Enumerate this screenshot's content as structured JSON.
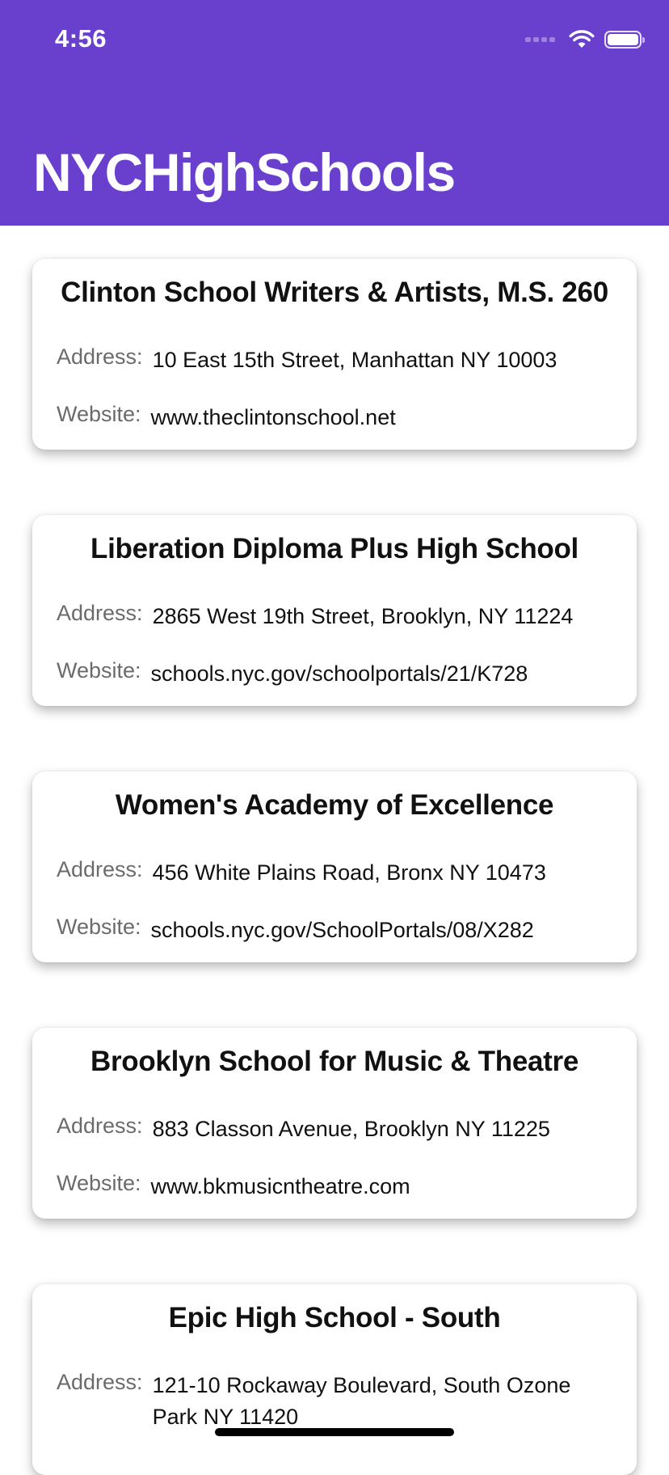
{
  "status_bar": {
    "time": "4:56"
  },
  "header": {
    "title": "NYCHighSchools",
    "background_color": "#6940CE"
  },
  "labels": {
    "address": "Address:",
    "website": "Website:"
  },
  "schools": [
    {
      "name": "Clinton School Writers & Artists, M.S. 260",
      "address": "10 East 15th Street, Manhattan NY 10003",
      "website": "www.theclintonschool.net"
    },
    {
      "name": "Liberation Diploma Plus High School",
      "address": "2865 West 19th Street, Brooklyn, NY 11224",
      "website": "schools.nyc.gov/schoolportals/21/K728"
    },
    {
      "name": "Women's Academy of Excellence",
      "address": "456 White Plains Road, Bronx NY 10473",
      "website": "schools.nyc.gov/SchoolPortals/08/X282"
    },
    {
      "name": "Brooklyn School for Music & Theatre",
      "address": "883 Classon Avenue, Brooklyn NY 11225",
      "website": "www.bkmusicntheatre.com"
    },
    {
      "name": "Epic High School - South",
      "address": "121-10 Rockaway Boulevard, South Ozone Park NY 11420",
      "website": ""
    }
  ]
}
